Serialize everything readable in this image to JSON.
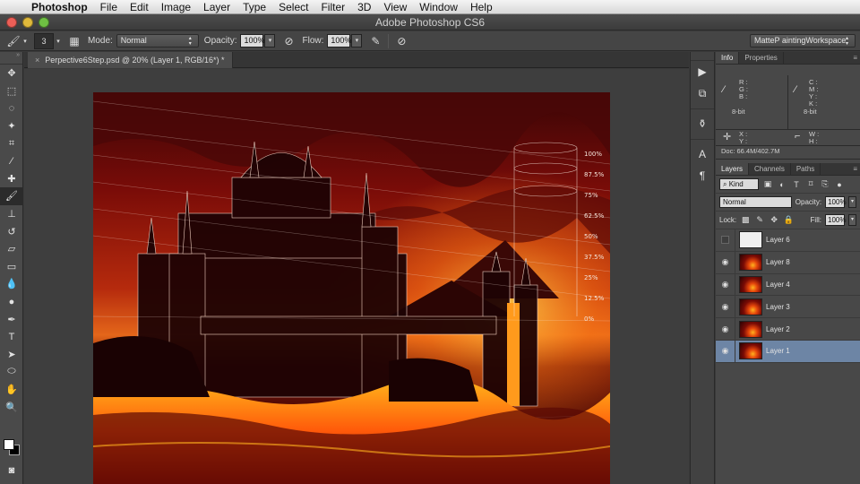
{
  "menubar": {
    "apple_icon": "apple-logo-icon",
    "app_name": "Photoshop",
    "items": [
      "File",
      "Edit",
      "Image",
      "Layer",
      "Type",
      "Select",
      "Filter",
      "3D",
      "View",
      "Window",
      "Help"
    ]
  },
  "window": {
    "title": "Adobe Photoshop CS6"
  },
  "options": {
    "brush_size": "3",
    "mode_label": "Mode:",
    "mode_value": "Normal",
    "opacity_label": "Opacity:",
    "opacity_value": "100%",
    "flow_label": "Flow:",
    "flow_value": "100%",
    "workspace": "MatteP aintingWorkspace"
  },
  "document": {
    "tab_title": "Perpective6Step.psd @ 20% (Layer 1, RGB/16*) *",
    "close_glyph": "×"
  },
  "info_panel": {
    "tabs": [
      "Info",
      "Properties"
    ],
    "rgb_labels": "R :\nG :\nB :",
    "cmyk_labels": "C :\nM :\nY :\nK :",
    "bit_left": "8-bit",
    "bit_right": "8-bit",
    "xy_labels": "X :\nY :",
    "wh_labels": "W :\nH :",
    "doc_size": "Doc: 66.4M/402.7M"
  },
  "layers_panel": {
    "tabs": [
      "Layers",
      "Channels",
      "Paths"
    ],
    "kind_label": "Kind",
    "blend_mode": "Normal",
    "opacity_label": "Opacity:",
    "opacity_value": "100%",
    "lock_label": "Lock:",
    "fill_label": "Fill:",
    "fill_value": "100%",
    "layers": [
      {
        "name": "Layer 6",
        "visible": false,
        "thumb": "sketch",
        "selected": false
      },
      {
        "name": "Layer 8",
        "visible": true,
        "thumb": "lava",
        "selected": false
      },
      {
        "name": "Layer 4",
        "visible": true,
        "thumb": "lava",
        "selected": false
      },
      {
        "name": "Layer 3",
        "visible": true,
        "thumb": "lava",
        "selected": false
      },
      {
        "name": "Layer 2",
        "visible": true,
        "thumb": "lava",
        "selected": false
      },
      {
        "name": "Layer 1",
        "visible": true,
        "thumb": "lava",
        "selected": true
      }
    ]
  },
  "artwork": {
    "scale_labels": [
      "100%",
      "87.5%",
      "75%",
      "62.5%",
      "50%",
      "37.5%",
      "25%",
      "12.5%",
      "0%"
    ]
  },
  "colors": {
    "selected_layer": "#6d85a5",
    "panel_bg": "#484848",
    "sky_red": "#8a0f08",
    "lava": "#ff6a10"
  }
}
